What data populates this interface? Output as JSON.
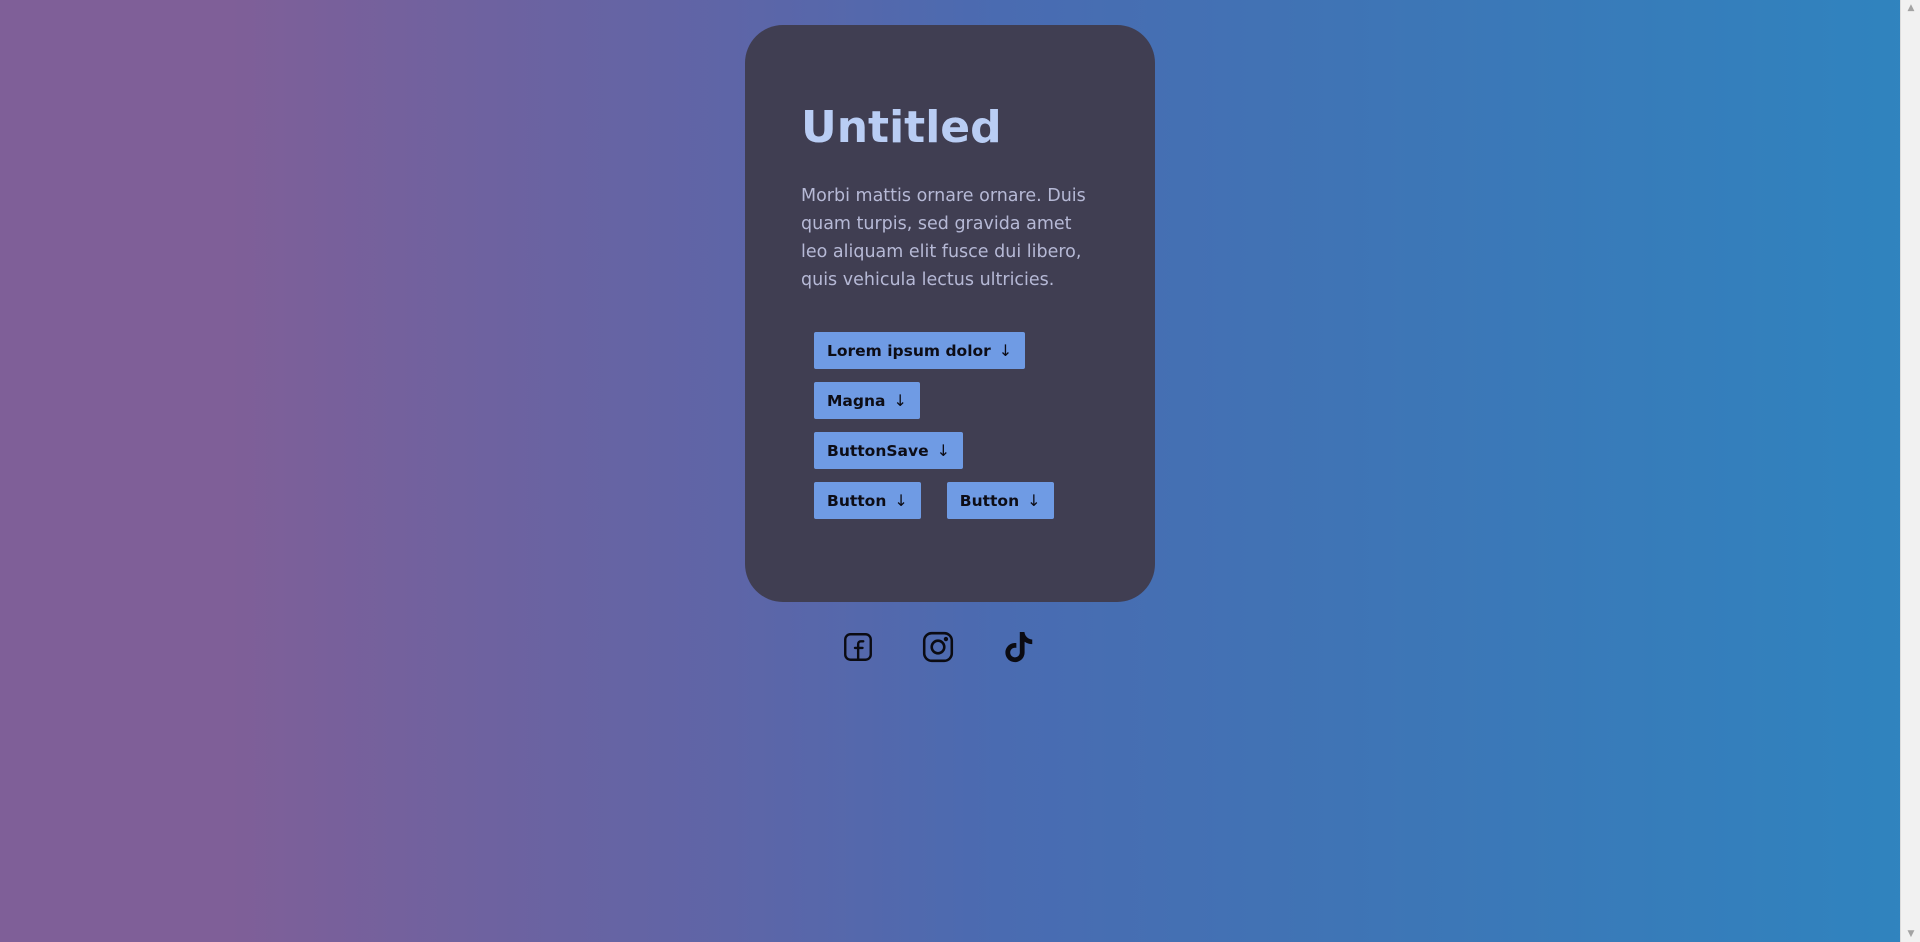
{
  "card": {
    "title": "Untitled",
    "description": "Morbi mattis ornare ornare. Duis quam turpis, sed gravida amet leo aliquam elit fusce dui libero, quis vehicula lectus ultricies.",
    "buttons": [
      {
        "label": "Lorem ipsum dolor",
        "icon": "arrow-down-icon"
      },
      {
        "label": "Magna",
        "icon": "arrow-down-icon"
      },
      {
        "label": "ButtonSave",
        "icon": "arrow-down-icon"
      },
      {
        "label": "Button",
        "icon": "arrow-down-icon"
      },
      {
        "label": "Button",
        "icon": "arrow-down-icon"
      }
    ],
    "arrow_glyph": "↓"
  },
  "social": [
    {
      "name": "facebook",
      "icon": "facebook-icon"
    },
    {
      "name": "instagram",
      "icon": "instagram-icon"
    },
    {
      "name": "tiktok",
      "icon": "tiktok-icon"
    }
  ],
  "colors": {
    "gradient_left": "#7f5f98",
    "gradient_right": "#2f84bf",
    "card_bg": "#403e52",
    "title": "#b9cdf4",
    "body_text": "#b6b9d6",
    "button_bg": "#6f9be4",
    "button_text": "#0d0d16"
  }
}
